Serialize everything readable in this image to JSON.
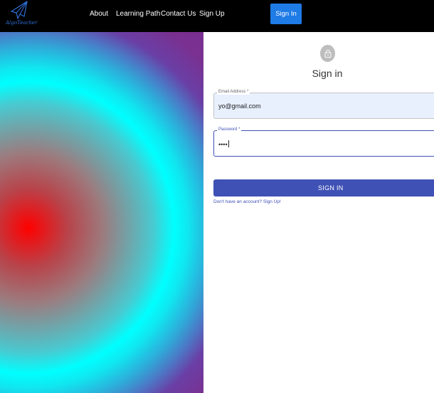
{
  "navbar": {
    "logo_text": "AlgoTeacher",
    "links": [
      "About",
      "Learning Path",
      "Contact Us",
      "Sign Up"
    ],
    "signin_label": "Sign In"
  },
  "colors": {
    "navbar_bg": "#000000",
    "signin_nav_bg": "#1f7be6",
    "primary": "#3f51b5",
    "autofill_bg": "#e8f0fe",
    "avatar_bg": "#bdbdbd"
  },
  "form": {
    "icon": "lock-icon",
    "title": "Sign in",
    "email": {
      "label": "Email Address *",
      "value": "yo@gmail.com"
    },
    "password": {
      "label": "Password *",
      "value": "••••"
    },
    "submit_label": "SIGN IN",
    "signup_link": "Don't have an account? Sign Up!"
  }
}
